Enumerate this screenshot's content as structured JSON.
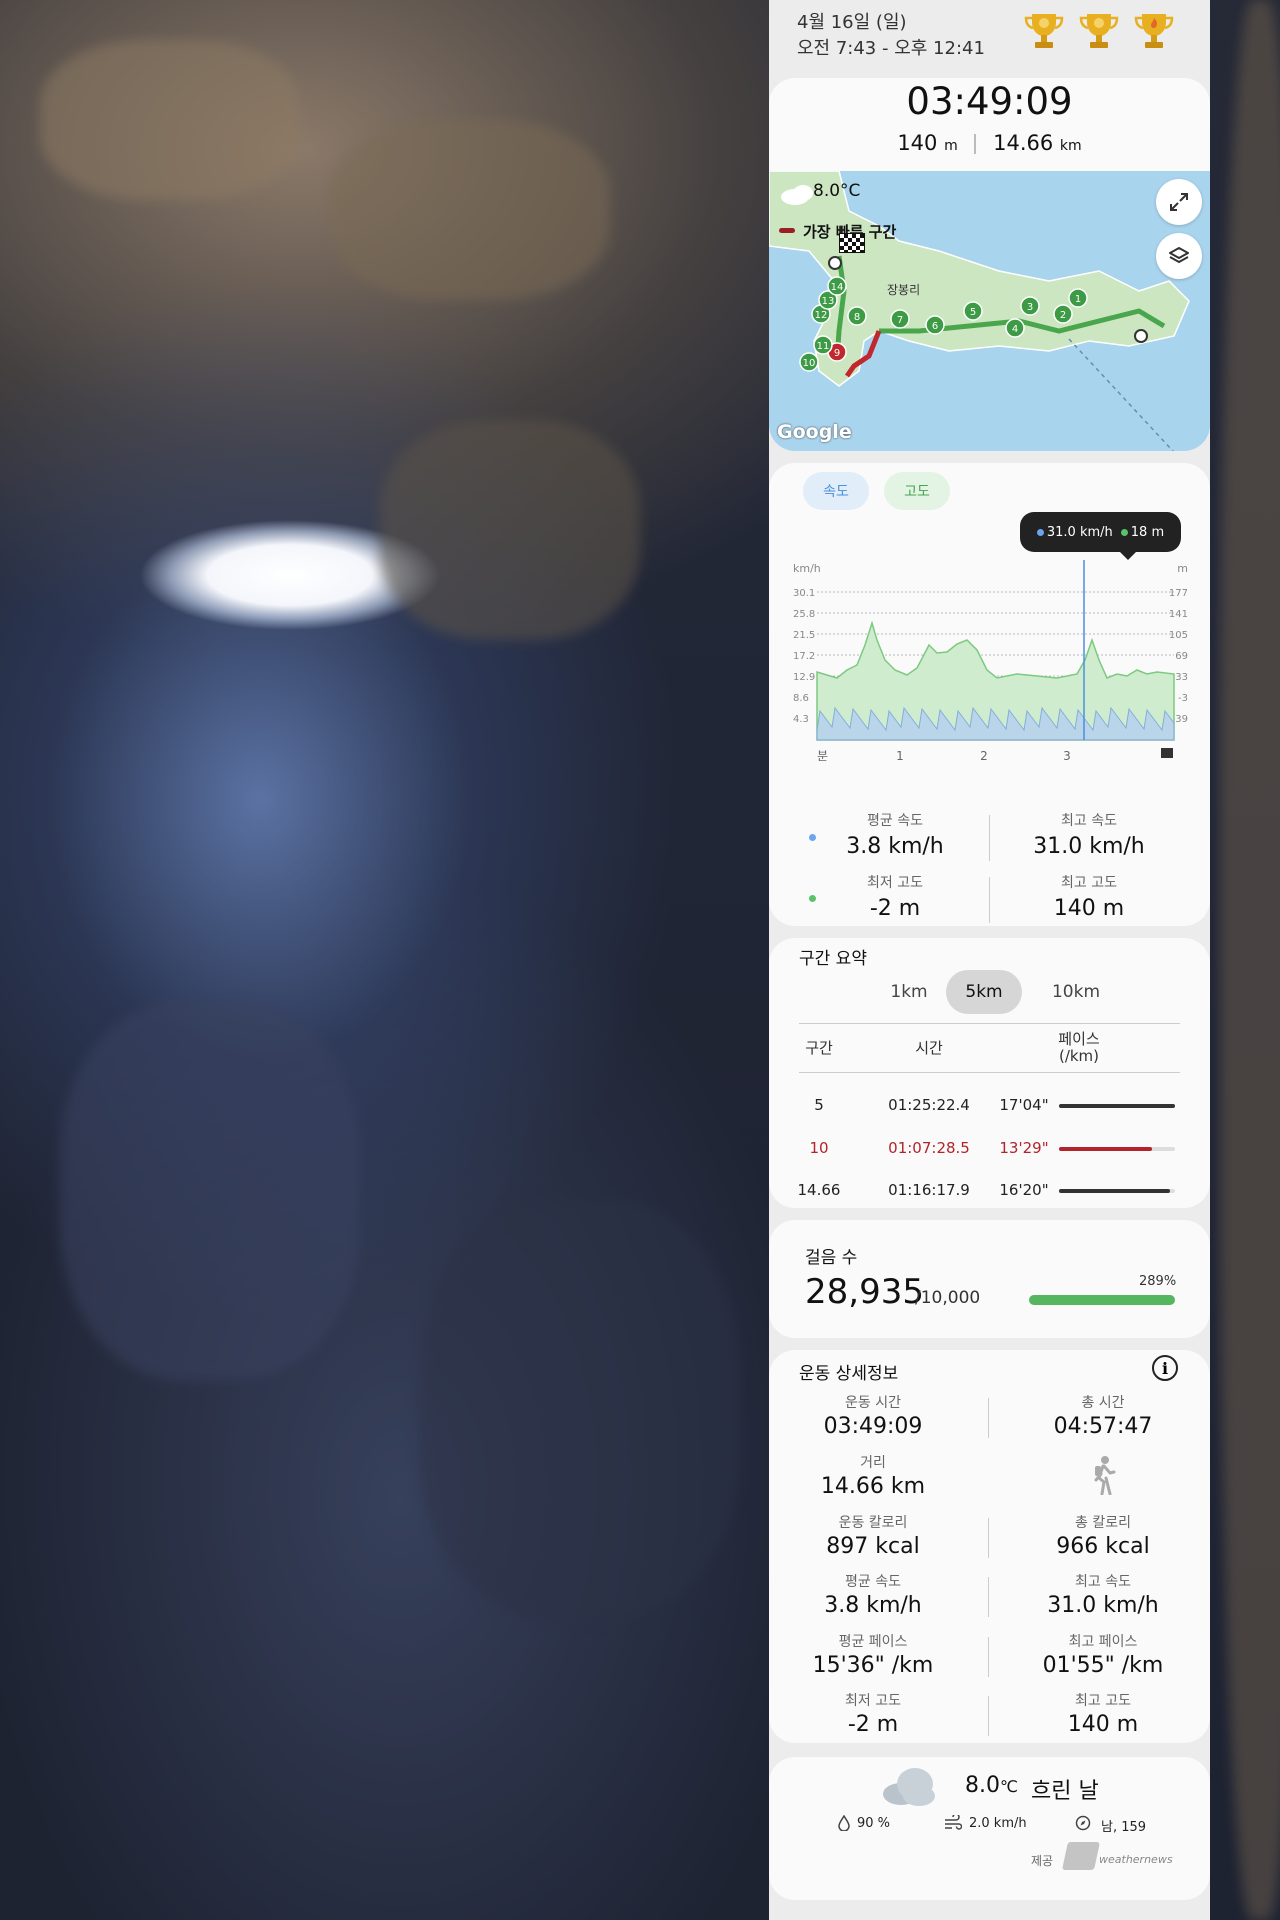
{
  "header": {
    "date": "4월 16일 (일)",
    "time_range": "오전 7:43 - 오후 12:41"
  },
  "summary": {
    "duration": "03:49:09",
    "elevation": "140",
    "elevation_unit": "m",
    "distance": "14.66",
    "distance_unit": "km"
  },
  "map": {
    "temperature": "8.0°C",
    "fastest_label": "가장 빠른 구간",
    "place": "장봉리",
    "google": "Google",
    "markers": [
      "1",
      "2",
      "3",
      "4",
      "5",
      "6",
      "7",
      "8",
      "9",
      "10",
      "11",
      "12",
      "13",
      "14"
    ]
  },
  "chart_tabs": {
    "speed": "속도",
    "altitude": "고도"
  },
  "tooltip": {
    "speed": "31.0 km/h",
    "altitude": "18 m"
  },
  "chart_data": {
    "type": "area",
    "left_unit": "km/h",
    "right_unit": "m",
    "left_ticks": [
      "30.1",
      "25.8",
      "21.5",
      "17.2",
      "12.9",
      "8.6",
      "4.3"
    ],
    "right_ticks": [
      "177",
      "141",
      "105",
      "69",
      "33",
      "-3",
      "-39"
    ],
    "x_ticks": [
      "분",
      "1",
      "2",
      "3"
    ],
    "series": [
      {
        "name": "속도",
        "color": "#4a8fe0"
      },
      {
        "name": "고도",
        "color": "#59c36a"
      }
    ]
  },
  "stats": {
    "avg_speed_label": "평균 속도",
    "avg_speed": "3.8 km/h",
    "max_speed_label": "최고 속도",
    "max_speed": "31.0 km/h",
    "min_alt_label": "최저 고도",
    "min_alt": "-2 m",
    "max_alt_label": "최고 고도",
    "max_alt": "140 m"
  },
  "splits": {
    "title": "구간 요약",
    "tabs": [
      "1km",
      "5km",
      "10km"
    ],
    "selected_tab": "5km",
    "headers": {
      "seg": "구간",
      "time": "시간",
      "pace": "페이스",
      "pace_unit": "(/km)"
    },
    "rows": [
      {
        "seg": "5",
        "time": "01:25:22.4",
        "pace": "17'04\"",
        "fill": 1.0,
        "fastest": false
      },
      {
        "seg": "10",
        "time": "01:07:28.5",
        "pace": "13'29\"",
        "fill": 0.8,
        "fastest": true
      },
      {
        "seg": "14.66",
        "time": "01:16:17.9",
        "pace": "16'20\"",
        "fill": 0.96,
        "fastest": false
      }
    ]
  },
  "steps": {
    "title": "걸음 수",
    "count": "28,935",
    "goal": "/10,000",
    "percent": "289%",
    "progress": 1.0
  },
  "details": {
    "title": "운동 상세정보",
    "exercise_time_label": "운동 시간",
    "exercise_time": "03:49:09",
    "total_time_label": "총 시간",
    "total_time": "04:57:47",
    "distance_label": "거리",
    "distance": "14.66 km",
    "exercise_cal_label": "운동 칼로리",
    "exercise_cal": "897 kcal",
    "total_cal_label": "총 칼로리",
    "total_cal": "966 kcal",
    "avg_speed_label": "평균 속도",
    "avg_speed": "3.8 km/h",
    "max_speed_label": "최고 속도",
    "max_speed": "31.0 km/h",
    "avg_pace_label": "평균 페이스",
    "avg_pace": "15'36\" /km",
    "max_pace_label": "최고 페이스",
    "max_pace": "01'55\" /km",
    "min_alt_label": "최저 고도",
    "min_alt": "-2 m",
    "max_alt_label": "최고 고도",
    "max_alt": "140 m"
  },
  "weather": {
    "temp": "8.0",
    "temp_unit": "℃",
    "condition": "흐린 날",
    "humidity": "90 %",
    "wind": "2.0 km/h",
    "direction": "남, 159",
    "provider_label": "제공",
    "provider": "weathernews"
  }
}
